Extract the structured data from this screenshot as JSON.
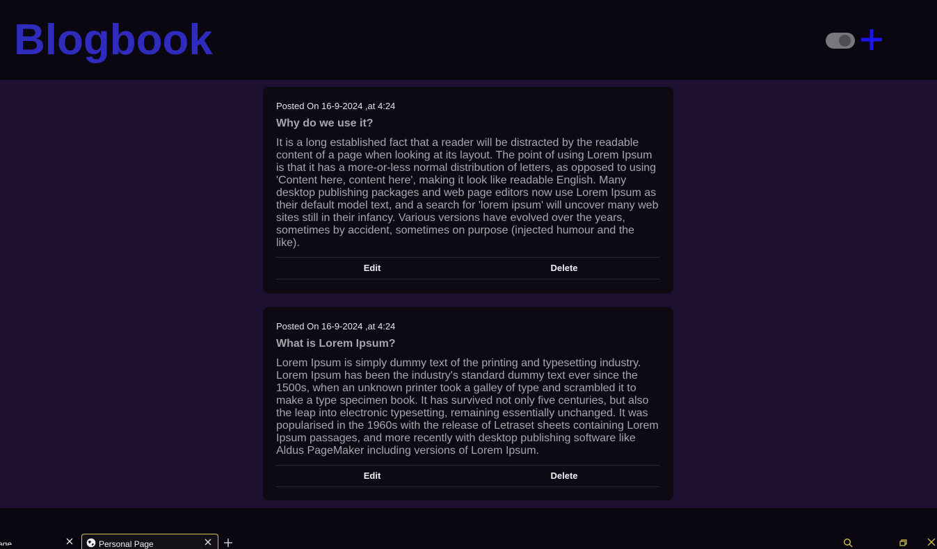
{
  "header": {
    "brand": "Blogbook",
    "theme_toggle_icon": "toggle-switch-icon",
    "add_icon": "plus-icon",
    "colors": {
      "brand": "#2f2bbd",
      "add": "#1a14f0",
      "header_bg": "#0b0710",
      "main_bg": "#1e1030",
      "card_bg": "#0e0a14"
    }
  },
  "posts": [
    {
      "posted": "Posted On 16-9-2024 ,at 4:24",
      "title": "Why do we use it?",
      "body": "It is a long established fact that a reader will be distracted by the readable content of a page when looking at its layout. The point of using Lorem Ipsum is that it has a more-or-less normal distribution of letters, as opposed to using 'Content here, content here', making it look like readable English. Many desktop publishing packages and web page editors now use Lorem Ipsum as their default model text, and a search for 'lorem ipsum' will uncover many web sites still in their infancy. Various versions have evolved over the years, sometimes by accident, sometimes on purpose (injected humour and the like).",
      "edit_label": "Edit",
      "delete_label": "Delete"
    },
    {
      "posted": "Posted On 16-9-2024 ,at 4:24",
      "title": "What is Lorem Ipsum?",
      "body": "Lorem Ipsum is simply dummy text of the printing and typesetting industry. Lorem Ipsum has been the industry's standard dummy text ever since the 1500s, when an unknown printer took a galley of type and scrambled it to make a type specimen book. It has survived not only five centuries, but also the leap into electronic typesetting, remaining essentially unchanged. It was popularised in the 1960s with the release of Letraset sheets containing Lorem Ipsum passages, and more recently with desktop publishing software like Aldus PageMaker including versions of Lorem Ipsum.",
      "edit_label": "Edit",
      "delete_label": "Delete"
    }
  ],
  "taskbar": {
    "prev_tab_label": "age",
    "active_tab_label": "Personal Page",
    "icons": [
      "close-icon",
      "globe-icon",
      "plus-icon",
      "search-icon",
      "restore-icon",
      "close-icon"
    ]
  }
}
